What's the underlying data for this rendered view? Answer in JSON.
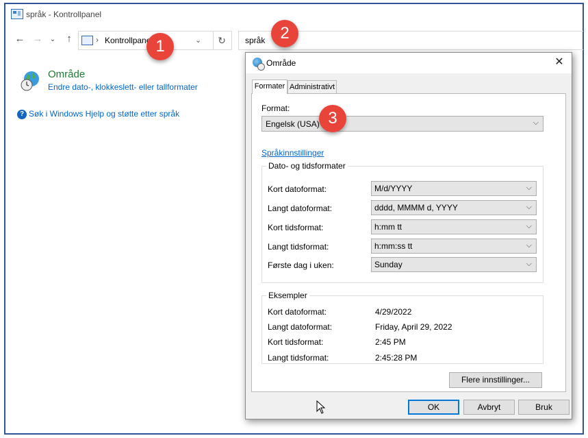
{
  "window": {
    "title": "språk - Kontrollpanel",
    "address_crumb": "Kontrollpanel",
    "search_text": "språk"
  },
  "results": {
    "area_title": "Område",
    "area_link": "Endre dato-, klokkeslett- eller tallformater",
    "help_link": "Søk i Windows Hjelp og støtte etter språk"
  },
  "badges": [
    "1",
    "2",
    "3"
  ],
  "dialog": {
    "title": "Område",
    "tabs": [
      {
        "label": "Formater",
        "selected": true
      },
      {
        "label": "Administrativt",
        "selected": false
      }
    ],
    "format_label": "Format:",
    "format_value": "Engelsk (USA)",
    "language_link": "Språkinnstillinger",
    "datetime_group": {
      "title": "Dato- og tidsformater",
      "rows": [
        {
          "label": "Kort datoformat:",
          "value": "M/d/YYYY"
        },
        {
          "label": "Langt datoformat:",
          "value": "dddd, MMMM d, YYYY"
        },
        {
          "label": "Kort tidsformat:",
          "value": "h:mm tt"
        },
        {
          "label": "Langt tidsformat:",
          "value": "h:mm:ss tt"
        },
        {
          "label": "Første dag i uken:",
          "value": "Sunday"
        }
      ]
    },
    "examples_group": {
      "title": "Eksempler",
      "rows": [
        {
          "label": "Kort datoformat:",
          "value": "4/29/2022"
        },
        {
          "label": "Langt datoformat:",
          "value": "Friday, April 29, 2022"
        },
        {
          "label": "Kort tidsformat:",
          "value": "2:45 PM"
        },
        {
          "label": "Langt tidsformat:",
          "value": "2:45:28 PM"
        }
      ]
    },
    "more_settings_label": "Flere innstillinger...",
    "buttons": {
      "ok": "OK",
      "cancel": "Avbryt",
      "apply": "Bruk"
    }
  },
  "colors": {
    "window_border": "#2f5597",
    "link": "#0066cc",
    "area_title": "#1e7b34",
    "badge": "#e8443a",
    "default_button_border": "#0078d7"
  }
}
